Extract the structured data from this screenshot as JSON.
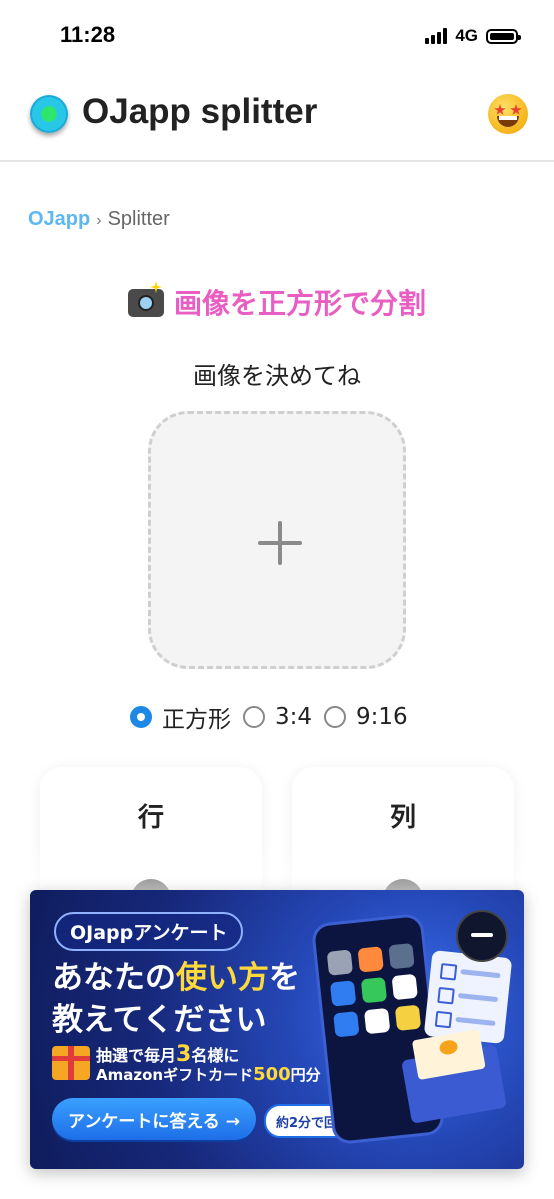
{
  "status_bar": {
    "time": "11:28",
    "network": "4G"
  },
  "header": {
    "title": "OJapp splitter"
  },
  "breadcrumb": {
    "home": "OJapp",
    "separator": "›",
    "current": "Splitter"
  },
  "page": {
    "heading": "画像を正方形で分割",
    "subtitle": "画像を決めてね"
  },
  "ratio_options": {
    "square": {
      "label": "正方形",
      "selected": true
    },
    "r34": {
      "label": "3:4",
      "selected": false
    },
    "r916": {
      "label": "9:16",
      "selected": false
    }
  },
  "cards": {
    "rows_label": "行",
    "cols_label": "列"
  },
  "ad": {
    "pill": "OJappアンケート",
    "line1_a": "あなたの",
    "line1_highlight": "使い方",
    "line1_b": "を",
    "line2": "教えてください",
    "prize1_a": "抽選で毎月",
    "prize1_num": "3",
    "prize1_b": "名様に",
    "prize2_a": "Amazonギフトカード",
    "prize2_num": "500",
    "prize2_b": "円分",
    "cta": "アンケートに答える →",
    "time_note": "約2分で回答"
  },
  "colors": {
    "accent_pink": "#e85ec2",
    "link_blue": "#5db7f0",
    "radio_blue": "#1e88e5"
  }
}
